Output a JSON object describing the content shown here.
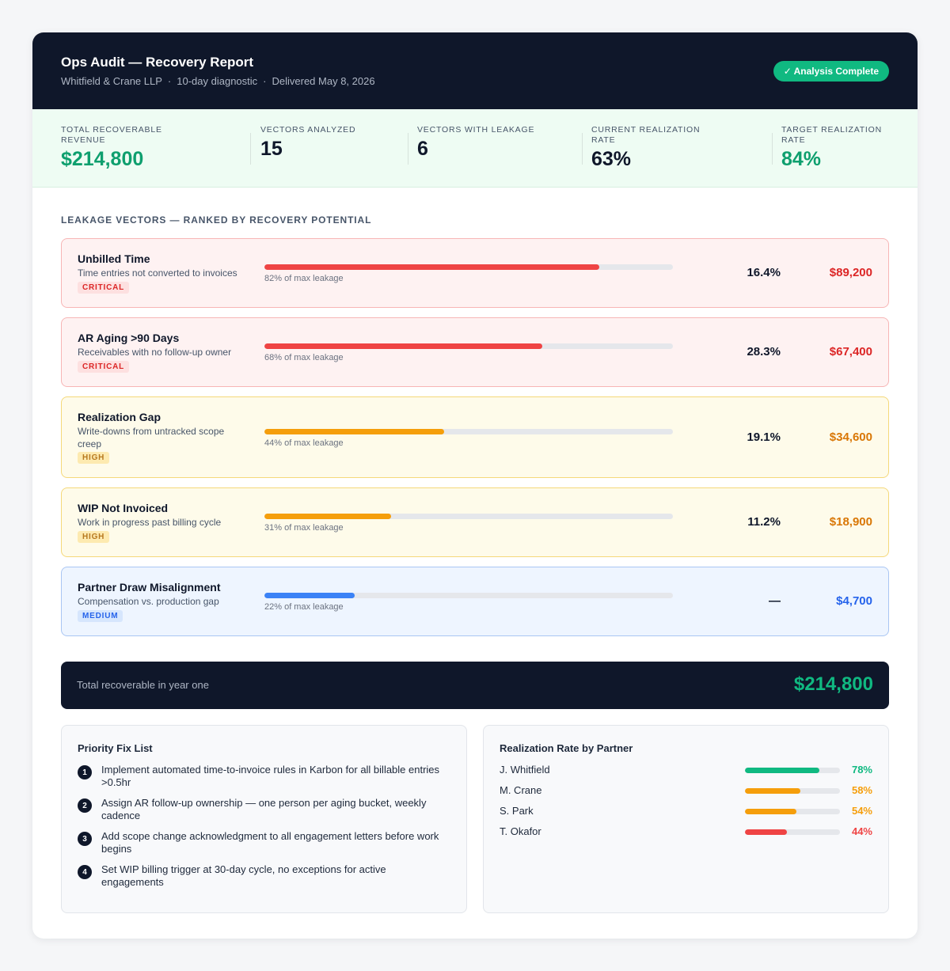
{
  "header": {
    "title": "Ops Audit — Recovery Report",
    "client": "Whitfield & Crane LLP",
    "scope": "10-day diagnostic",
    "delivered": "Delivered May 8, 2026",
    "sep": "·",
    "status_badge": "✓ Analysis Complete",
    "status_color": "#10b981"
  },
  "stats": [
    {
      "label": "Total Recoverable Revenue",
      "value": "$214,800",
      "accent": true
    },
    {
      "label": "Vectors Analyzed",
      "value": "15",
      "accent": false
    },
    {
      "label": "Vectors With Leakage",
      "value": "6",
      "accent": false
    },
    {
      "label": "Current Realization Rate",
      "value": "63%",
      "accent": false
    },
    {
      "label": "Target Realization Rate",
      "value": "84%",
      "accent": true
    }
  ],
  "section_title": "Leakage Vectors — Ranked by Recovery Potential",
  "vectors": [
    {
      "name": "Unbilled Time",
      "desc": "Time entries not converted to invoices",
      "severity": "CRITICAL",
      "fill": 0.82,
      "bar_caption": "82% of max leakage",
      "pct": "16.4%",
      "amount": "$89,200"
    },
    {
      "name": "AR Aging >90 Days",
      "desc": "Receivables with no follow-up owner",
      "severity": "CRITICAL",
      "fill": 0.68,
      "bar_caption": "68% of max leakage",
      "pct": "28.3%",
      "amount": "$67,400"
    },
    {
      "name": "Realization Gap",
      "desc": "Write-downs from untracked scope creep",
      "severity": "HIGH",
      "fill": 0.44,
      "bar_caption": "44% of max leakage",
      "pct": "19.1%",
      "amount": "$34,600"
    },
    {
      "name": "WIP Not Invoiced",
      "desc": "Work in progress past billing cycle",
      "severity": "HIGH",
      "fill": 0.31,
      "bar_caption": "31% of max leakage",
      "pct": "11.2%",
      "amount": "$18,900"
    },
    {
      "name": "Partner Draw Misalignment",
      "desc": "Compensation vs. production gap",
      "severity": "MEDIUM",
      "fill": 0.22,
      "bar_caption": "22% of max leakage",
      "pct": "—",
      "amount": "$4,700"
    }
  ],
  "total": {
    "label": "Total recoverable in year one",
    "value": "$214,800"
  },
  "priority": {
    "title": "Priority Fix List",
    "items": [
      {
        "num": "1",
        "text": "Implement automated time-to-invoice rules in Karbon for all billable entries >0.5hr"
      },
      {
        "num": "2",
        "text": "Assign AR follow-up ownership — one person per aging bucket, weekly cadence"
      },
      {
        "num": "3",
        "text": "Add scope change acknowledgment to all engagement letters before work begins"
      },
      {
        "num": "4",
        "text": "Set WIP billing trigger at 30-day cycle, no exceptions for active engagements"
      }
    ]
  },
  "partners": {
    "title": "Realization Rate by Partner",
    "rows": [
      {
        "name": "J. Whitfield",
        "value": "78%",
        "fill": 0.78,
        "color": "#10b981"
      },
      {
        "name": "M. Crane",
        "value": "58%",
        "fill": 0.58,
        "color": "#f59e0b"
      },
      {
        "name": "S. Park",
        "value": "54%",
        "fill": 0.54,
        "color": "#f59e0b"
      },
      {
        "name": "T. Okafor",
        "value": "44%",
        "fill": 0.44,
        "color": "#ef4444"
      }
    ]
  }
}
